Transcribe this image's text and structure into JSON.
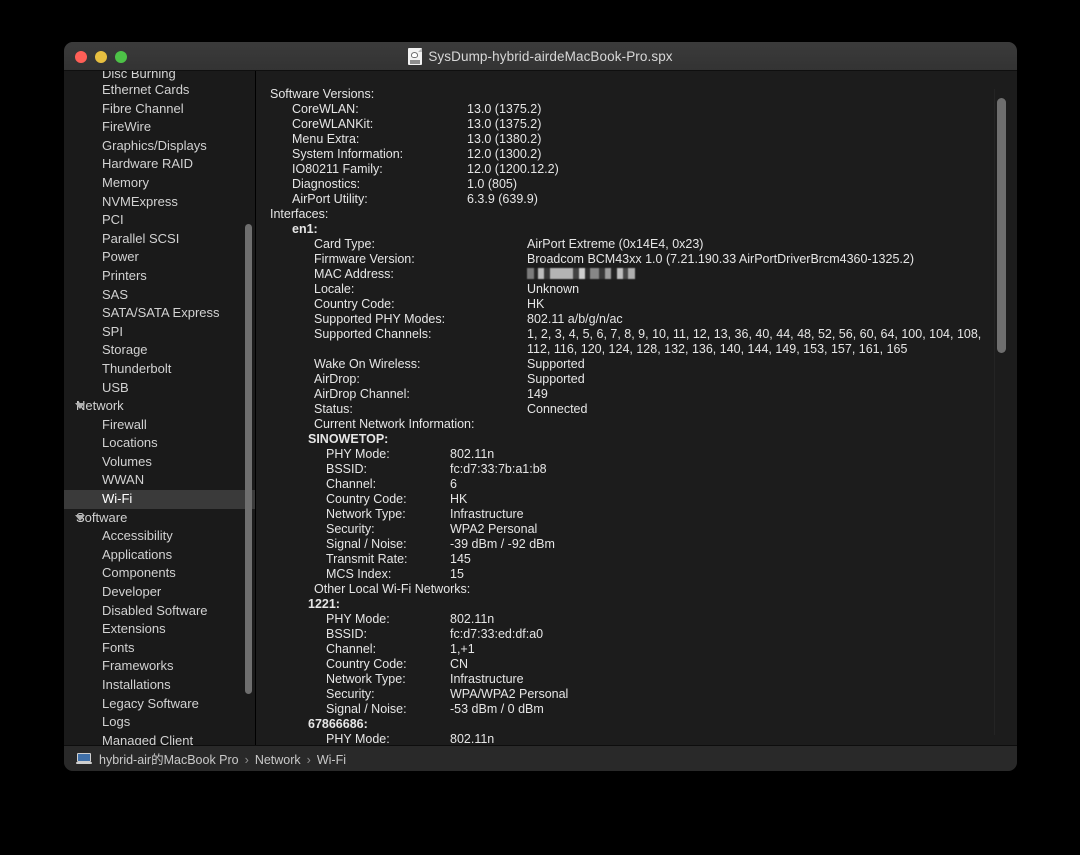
{
  "window": {
    "title": "SysDump-hybrid-airdeMacBook-Pro.spx",
    "doc_icon": "spx-document-icon",
    "lights": {
      "close": "close-button",
      "minimize": "minimize-button",
      "maximize": "maximize-button"
    }
  },
  "sidebar": {
    "items": [
      {
        "label": "Disc Burning",
        "type": "item",
        "clipped": true
      },
      {
        "label": "Ethernet Cards",
        "type": "item"
      },
      {
        "label": "Fibre Channel",
        "type": "item"
      },
      {
        "label": "FireWire",
        "type": "item"
      },
      {
        "label": "Graphics/Displays",
        "type": "item"
      },
      {
        "label": "Hardware RAID",
        "type": "item"
      },
      {
        "label": "Memory",
        "type": "item"
      },
      {
        "label": "NVMExpress",
        "type": "item"
      },
      {
        "label": "PCI",
        "type": "item"
      },
      {
        "label": "Parallel SCSI",
        "type": "item"
      },
      {
        "label": "Power",
        "type": "item"
      },
      {
        "label": "Printers",
        "type": "item"
      },
      {
        "label": "SAS",
        "type": "item"
      },
      {
        "label": "SATA/SATA Express",
        "type": "item"
      },
      {
        "label": "SPI",
        "type": "item"
      },
      {
        "label": "Storage",
        "type": "item"
      },
      {
        "label": "Thunderbolt",
        "type": "item"
      },
      {
        "label": "USB",
        "type": "item"
      },
      {
        "label": "Network",
        "type": "group"
      },
      {
        "label": "Firewall",
        "type": "item"
      },
      {
        "label": "Locations",
        "type": "item"
      },
      {
        "label": "Volumes",
        "type": "item"
      },
      {
        "label": "WWAN",
        "type": "item"
      },
      {
        "label": "Wi-Fi",
        "type": "item",
        "selected": true
      },
      {
        "label": "Software",
        "type": "group"
      },
      {
        "label": "Accessibility",
        "type": "item"
      },
      {
        "label": "Applications",
        "type": "item"
      },
      {
        "label": "Components",
        "type": "item"
      },
      {
        "label": "Developer",
        "type": "item"
      },
      {
        "label": "Disabled Software",
        "type": "item"
      },
      {
        "label": "Extensions",
        "type": "item"
      },
      {
        "label": "Fonts",
        "type": "item"
      },
      {
        "label": "Frameworks",
        "type": "item"
      },
      {
        "label": "Installations",
        "type": "item"
      },
      {
        "label": "Legacy Software",
        "type": "item"
      },
      {
        "label": "Logs",
        "type": "item"
      },
      {
        "label": "Managed Client",
        "type": "item"
      }
    ]
  },
  "content": {
    "lines": [
      {
        "indent": 0,
        "key": "Software Versions:",
        "value": ""
      },
      {
        "indent": 1,
        "key": "CoreWLAN:",
        "value": "13.0 (1375.2)"
      },
      {
        "indent": 1,
        "key": "CoreWLANKit:",
        "value": "13.0 (1375.2)"
      },
      {
        "indent": 1,
        "key": "Menu Extra:",
        "value": "13.0 (1380.2)"
      },
      {
        "indent": 1,
        "key": "System Information:",
        "value": "12.0 (1300.2)"
      },
      {
        "indent": 1,
        "key": "IO80211 Family:",
        "value": "12.0 (1200.12.2)"
      },
      {
        "indent": 1,
        "key": "Diagnostics:",
        "value": "1.0 (805)"
      },
      {
        "indent": 1,
        "key": "AirPort Utility:",
        "value": "6.3.9 (639.9)"
      },
      {
        "indent": 0,
        "key": "Interfaces:",
        "value": ""
      },
      {
        "indent": 1,
        "key": "en1:",
        "value": "",
        "bold": true
      },
      {
        "indent": 2,
        "key": "Card Type:",
        "value": "AirPort Extreme  (0x14E4, 0x23)"
      },
      {
        "indent": 2,
        "key": "Firmware Version:",
        "value": "Broadcom BCM43xx 1.0 (7.21.190.33 AirPortDriverBrcm4360-1325.2)"
      },
      {
        "indent": 2,
        "key": "MAC Address:",
        "value": "",
        "redacted": true
      },
      {
        "indent": 2,
        "key": "Locale:",
        "value": "Unknown"
      },
      {
        "indent": 2,
        "key": "Country Code:",
        "value": "HK"
      },
      {
        "indent": 2,
        "key": "Supported PHY Modes:",
        "value": "802.11 a/b/g/n/ac"
      },
      {
        "indent": 2,
        "key": "Supported Channels:",
        "value": "1, 2, 3, 4, 5, 6, 7, 8, 9, 10, 11, 12, 13, 36, 40, 44, 48, 52, 56, 60, 64, 100, 104, 108,"
      },
      {
        "indent": 2,
        "key": "",
        "value": "112, 116, 120, 124, 128, 132, 136, 140, 144, 149, 153, 157, 161, 165"
      },
      {
        "indent": 2,
        "key": "Wake On Wireless:",
        "value": "Supported"
      },
      {
        "indent": 2,
        "key": "AirDrop:",
        "value": "Supported"
      },
      {
        "indent": 2,
        "key": "AirDrop Channel:",
        "value": "149"
      },
      {
        "indent": 2,
        "key": "Status:",
        "value": "Connected"
      },
      {
        "indent": 2,
        "key": "Current Network Information:",
        "value": ""
      },
      {
        "indent": 3,
        "key": "SINOWETOP:",
        "value": "",
        "bold": true
      },
      {
        "indent": 4,
        "key": "PHY Mode:",
        "value": "802.11n"
      },
      {
        "indent": 4,
        "key": "BSSID:",
        "value": "fc:d7:33:7b:a1:b8"
      },
      {
        "indent": 4,
        "key": "Channel:",
        "value": "6"
      },
      {
        "indent": 4,
        "key": "Country Code:",
        "value": "HK"
      },
      {
        "indent": 4,
        "key": "Network Type:",
        "value": "Infrastructure"
      },
      {
        "indent": 4,
        "key": "Security:",
        "value": "WPA2 Personal"
      },
      {
        "indent": 4,
        "key": "Signal / Noise:",
        "value": "-39 dBm / -92 dBm"
      },
      {
        "indent": 4,
        "key": "Transmit Rate:",
        "value": "145"
      },
      {
        "indent": 4,
        "key": "MCS Index:",
        "value": "15"
      },
      {
        "indent": 2,
        "key": "Other Local Wi-Fi Networks:",
        "value": ""
      },
      {
        "indent": 3,
        "key": "1221:",
        "value": "",
        "bold": true
      },
      {
        "indent": 4,
        "key": "PHY Mode:",
        "value": "802.11n"
      },
      {
        "indent": 4,
        "key": "BSSID:",
        "value": "fc:d7:33:ed:df:a0"
      },
      {
        "indent": 4,
        "key": "Channel:",
        "value": "1,+1"
      },
      {
        "indent": 4,
        "key": "Country Code:",
        "value": "CN"
      },
      {
        "indent": 4,
        "key": "Network Type:",
        "value": "Infrastructure"
      },
      {
        "indent": 4,
        "key": "Security:",
        "value": "WPA/WPA2 Personal"
      },
      {
        "indent": 4,
        "key": "Signal / Noise:",
        "value": "-53 dBm / 0 dBm"
      },
      {
        "indent": 3,
        "key": "67866686:",
        "value": "",
        "bold": true
      },
      {
        "indent": 4,
        "key": "PHY Mode:",
        "value": "802.11n"
      }
    ]
  },
  "statusbar": {
    "device_icon": "macbook-icon",
    "crumbs": [
      "hybrid-air的MacBook Pro",
      "Network",
      "Wi-Fi"
    ],
    "separator": "›"
  }
}
